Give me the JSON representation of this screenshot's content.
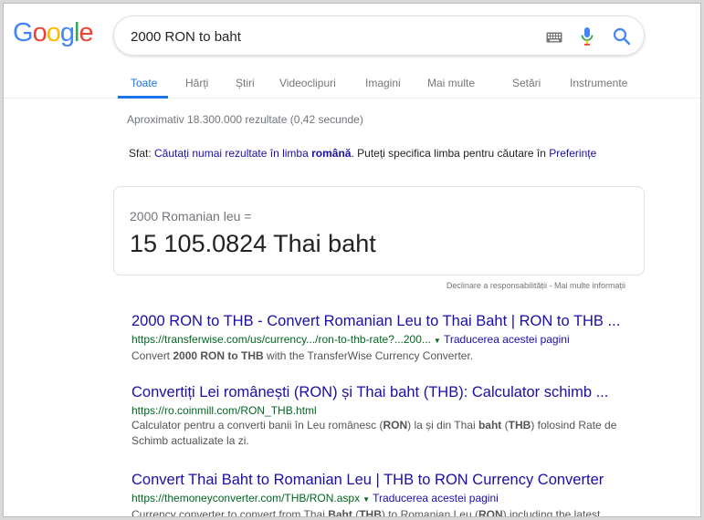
{
  "logo": {
    "letters": [
      {
        "ch": "G",
        "color": "#4285f4"
      },
      {
        "ch": "o",
        "color": "#ea4335"
      },
      {
        "ch": "o",
        "color": "#fbbc05"
      },
      {
        "ch": "g",
        "color": "#4285f4"
      },
      {
        "ch": "l",
        "color": "#34a853"
      },
      {
        "ch": "e",
        "color": "#ea4335"
      }
    ]
  },
  "search": {
    "query": "2000 RON to baht",
    "icons": [
      "keyboard-icon",
      "mic-icon",
      "search-icon"
    ]
  },
  "tabs": [
    {
      "label": "Toate",
      "active": true
    },
    {
      "label": "Hărți",
      "active": false
    },
    {
      "label": "Știri",
      "active": false
    },
    {
      "label": "Videoclipuri",
      "active": false
    },
    {
      "label": "Imagini",
      "active": false
    },
    {
      "label": "Mai multe",
      "active": false
    },
    {
      "label": "Setări",
      "active": false
    },
    {
      "label": "Instrumente",
      "active": false
    }
  ],
  "stats": "Aproximativ 18.300.000 rezultate (0,42 secunde)",
  "tip": {
    "prefix": "Sfat: ",
    "link_text": "Căutați numai rezultate în limba ",
    "link_bold": "română",
    "middle": ". Puteți specifica limba pentru căutare în ",
    "pref_link": "Preferințe"
  },
  "converter": {
    "from": "2000 Romanian leu =",
    "to": "15 105.0824 Thai baht"
  },
  "disclaimer": {
    "text": "Declinare a responsabilității",
    "sep": " - ",
    "more": "Mai multe informații"
  },
  "results": [
    {
      "title": "2000 RON to THB - Convert Romanian Leu to Thai Baht | RON to THB ...",
      "url": "https://transferwise.com/us/currency.../ron-to-thb-rate?...200...",
      "translate": "Traducerea acestei pagini",
      "snippet_parts": [
        {
          "t": "Convert ",
          "b": false
        },
        {
          "t": "2000 RON to THB",
          "b": true
        },
        {
          "t": " with the TransferWise Currency Converter.",
          "b": false
        }
      ]
    },
    {
      "title": "Convertiți Lei românești (RON) și Thai baht (THB): Calculator schimb ...",
      "url": "https://ro.coinmill.com/RON_THB.html",
      "translate": "",
      "snippet_parts": [
        {
          "t": "Calculator pentru a converti banii în Leu românesc (",
          "b": false
        },
        {
          "t": "RON",
          "b": true
        },
        {
          "t": ") la și din Thai ",
          "b": false
        },
        {
          "t": "baht",
          "b": true
        },
        {
          "t": " (",
          "b": false
        },
        {
          "t": "THB",
          "b": true
        },
        {
          "t": ") folosind Rate de Schimb actualizate la zi.",
          "b": false
        }
      ]
    },
    {
      "title": "Convert Thai Baht to Romanian Leu | THB to RON Currency Converter",
      "url": "https://themoneyconverter.com/THB/RON.aspx",
      "translate": "Traducerea acestei pagini",
      "snippet_parts": [
        {
          "t": "Currency converter to convert from Thai ",
          "b": false
        },
        {
          "t": "Baht",
          "b": true
        },
        {
          "t": " (",
          "b": false
        },
        {
          "t": "THB",
          "b": true
        },
        {
          "t": ") to Romanian Leu (",
          "b": false
        },
        {
          "t": "RON",
          "b": true
        },
        {
          "t": ") including the latest",
          "b": false
        }
      ]
    }
  ]
}
